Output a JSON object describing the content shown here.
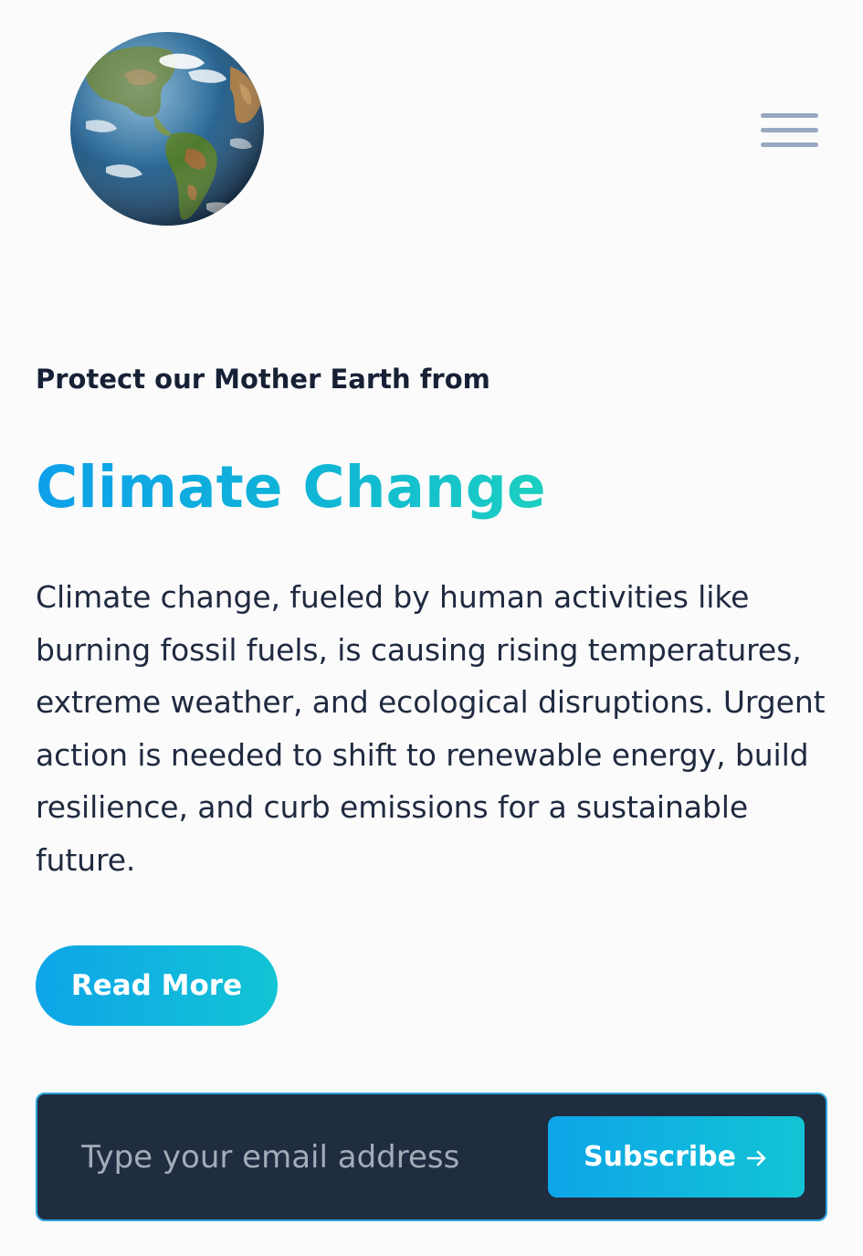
{
  "header": {
    "logo_icon": "earth-globe-icon",
    "menu_icon": "hamburger-menu-icon"
  },
  "hero": {
    "eyebrow": "Protect our Mother Earth from",
    "title": "Climate Change",
    "description": "Climate change, fueled by human activities like burning fossil fuels, is causing rising temperatures, extreme weather, and ecological disruptions. Urgent action is needed to shift to renewable energy, build resilience, and curb emissions for a sustainable future.",
    "read_more_label": "Read More"
  },
  "subscribe": {
    "placeholder": "Type your email address",
    "button_label": "Subscribe",
    "button_icon": "arrow-right-icon"
  },
  "colors": {
    "background": "#fbfbfb",
    "text_dark": "#1b2438",
    "gradient_start": "#0ea5e9",
    "gradient_end": "#1ccfc0",
    "subscribe_bg": "#202d40",
    "menu_bar": "#98a8c0"
  }
}
